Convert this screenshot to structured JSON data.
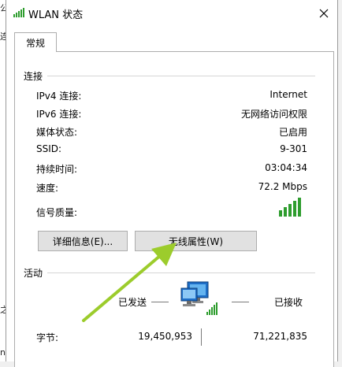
{
  "window": {
    "title": "WLAN 状态"
  },
  "tabs": [
    {
      "label": "常规"
    }
  ],
  "connection": {
    "group_label": "连接",
    "rows": [
      {
        "label": "IPv4 连接:",
        "value": "Internet"
      },
      {
        "label": "IPv6 连接:",
        "value": "无网络访问权限"
      },
      {
        "label": "媒体状态:",
        "value": "已启用"
      },
      {
        "label": "SSID:",
        "value": "9-301"
      },
      {
        "label": "持续时间:",
        "value": "03:04:34"
      },
      {
        "label": "速度:",
        "value": "72.2 Mbps"
      }
    ],
    "signal_label": "信号质量:",
    "signal_bars": 5,
    "signal_max_bars": 5,
    "details_button": "详细信息(E)...",
    "wireless_button": "无线属性(W)"
  },
  "activity": {
    "group_label": "活动",
    "sent_label": "已发送",
    "received_label": "已接收",
    "bytes_label": "字节:",
    "bytes_sent": "19,450,953",
    "bytes_received": "71,221,835"
  },
  "left_edge": [
    "公",
    "连",
    "之",
    "n"
  ],
  "colors": {
    "signal": "#2e9d2e",
    "arrow": "#9ccc2c",
    "accent": "#0a64b4"
  }
}
